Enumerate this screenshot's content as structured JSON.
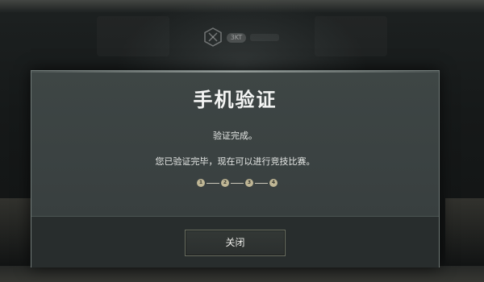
{
  "background": {
    "badge_label": "3KT"
  },
  "dialog": {
    "title": "手机验证",
    "status": "验证完成。",
    "message": "您已验证完毕，现在可以进行竞技比赛。",
    "steps": [
      "1",
      "2",
      "3",
      "4"
    ],
    "close_label": "关闭"
  },
  "colors": {
    "dialog_bg": "#3a4141",
    "footer_bg": "#282d2d",
    "step_dot": "#bfb695",
    "text": "#f4f5f4"
  }
}
